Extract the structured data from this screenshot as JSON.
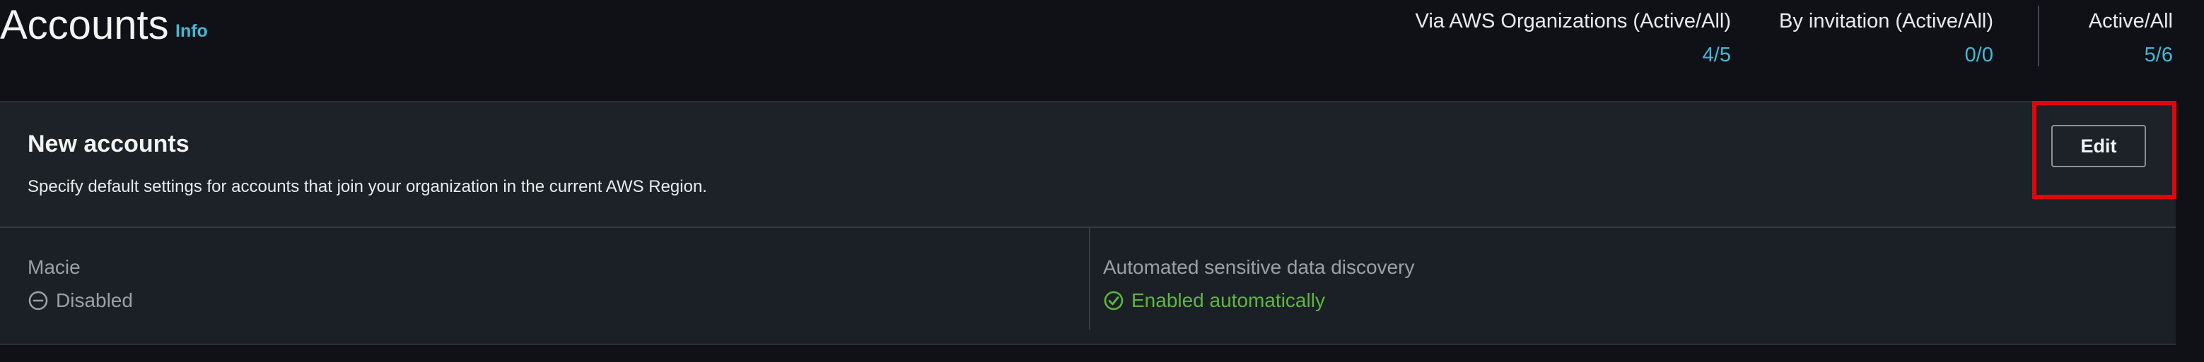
{
  "header": {
    "title": "Accounts",
    "info_link": "Info",
    "stats": {
      "organizations": {
        "label": "Via AWS Organizations (Active/All)",
        "value": "4/5"
      },
      "invitation": {
        "label": "By invitation (Active/All)",
        "value": "0/0"
      },
      "total": {
        "label": "Active/All",
        "value": "5/6"
      }
    }
  },
  "new_accounts": {
    "title": "New accounts",
    "description": "Specify default settings for accounts that join your organization in the current AWS Region.",
    "edit_label": "Edit",
    "settings": {
      "macie": {
        "label": "Macie",
        "status": "Disabled",
        "icon": "minus-circle-icon",
        "color": "#9ba0a8"
      },
      "discovery": {
        "label": "Automated sensitive data discovery",
        "status": "Enabled automatically",
        "icon": "check-circle-icon",
        "color": "#5fb63f"
      }
    }
  },
  "colors": {
    "accent_link": "#44b9d6",
    "highlight": "#e0070c"
  }
}
